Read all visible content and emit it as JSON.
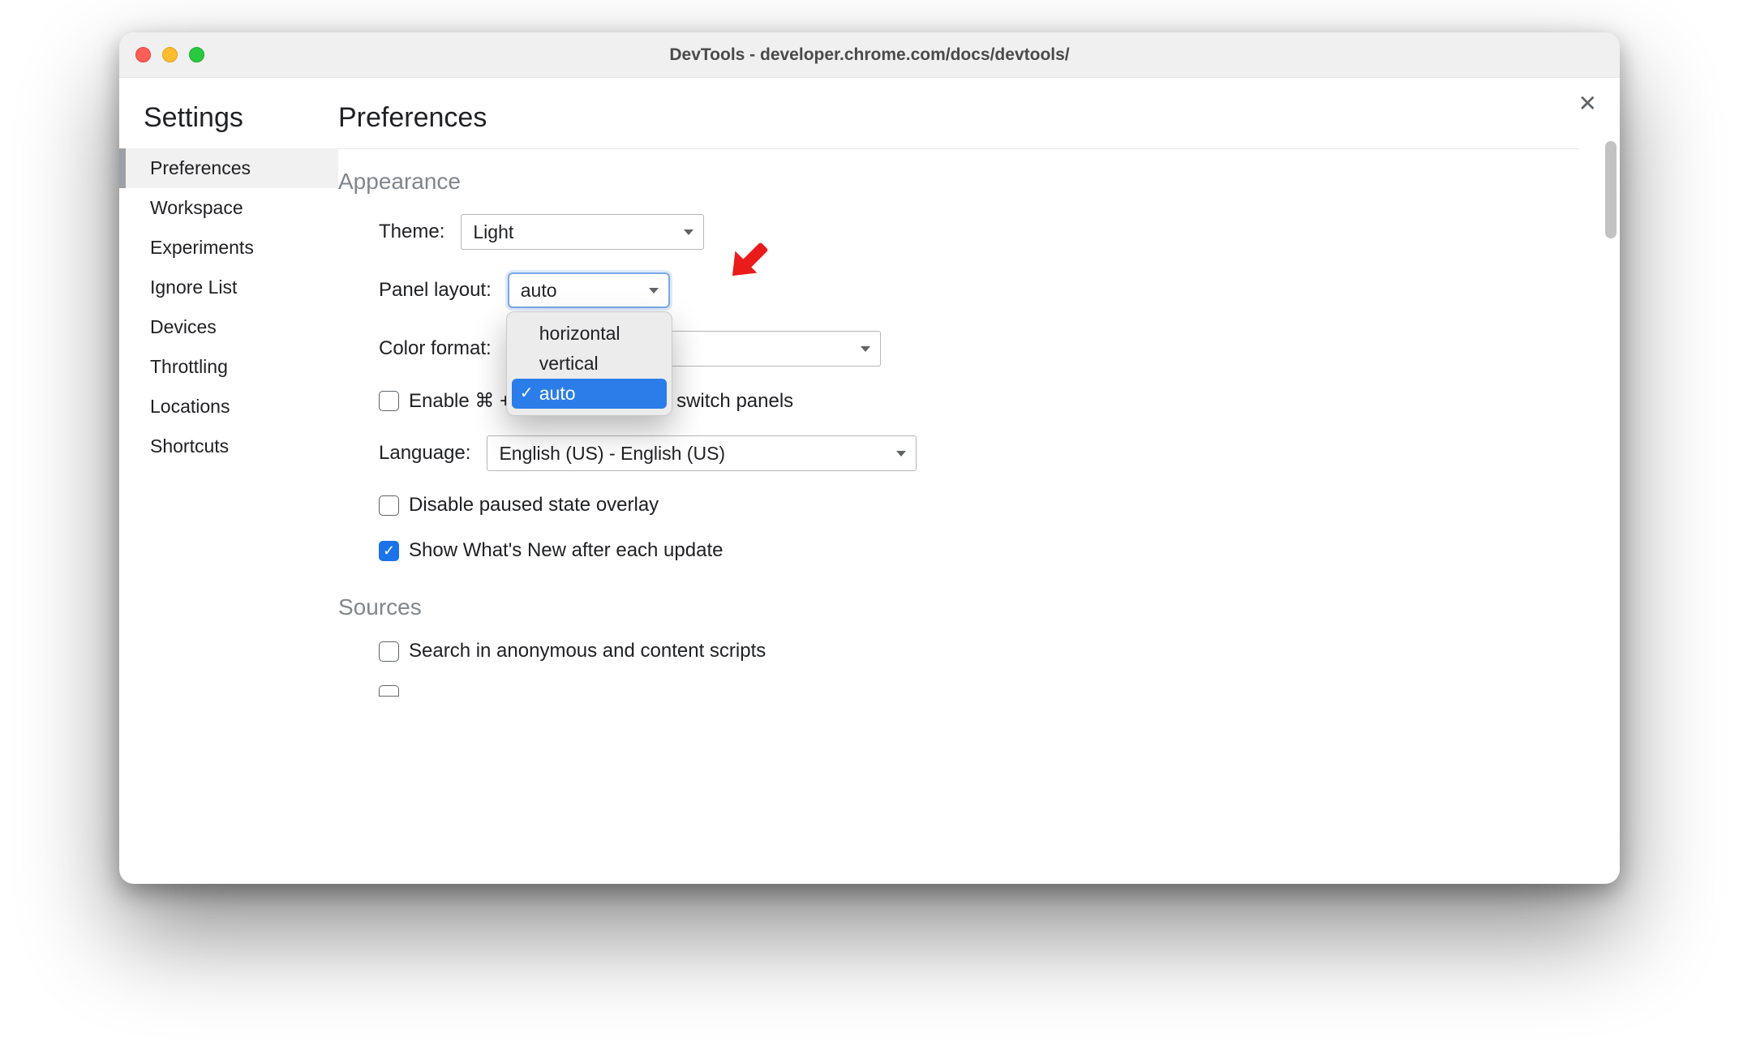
{
  "window_title": "DevTools - developer.chrome.com/docs/devtools/",
  "sidebar": {
    "heading": "Settings",
    "items": [
      {
        "label": "Preferences",
        "active": true
      },
      {
        "label": "Workspace"
      },
      {
        "label": "Experiments"
      },
      {
        "label": "Ignore List"
      },
      {
        "label": "Devices"
      },
      {
        "label": "Throttling"
      },
      {
        "label": "Locations"
      },
      {
        "label": "Shortcuts"
      }
    ]
  },
  "page_title": "Preferences",
  "appearance": {
    "heading": "Appearance",
    "theme_label": "Theme:",
    "theme_value": "Light",
    "panel_layout_label": "Panel layout:",
    "panel_layout_value": "auto",
    "panel_layout_options": [
      "horizontal",
      "vertical",
      "auto"
    ],
    "color_format_label": "Color format:",
    "enable_shortcut_prefix": "Enable ⌘ + ",
    "enable_shortcut_suffix": " switch panels",
    "language_label": "Language:",
    "language_value": "English (US) - English (US)",
    "disable_paused_label": "Disable paused state overlay",
    "show_whats_new_label": "Show What's New after each update"
  },
  "sources": {
    "heading": "Sources",
    "search_anon_label": "Search in anonymous and content scripts"
  }
}
